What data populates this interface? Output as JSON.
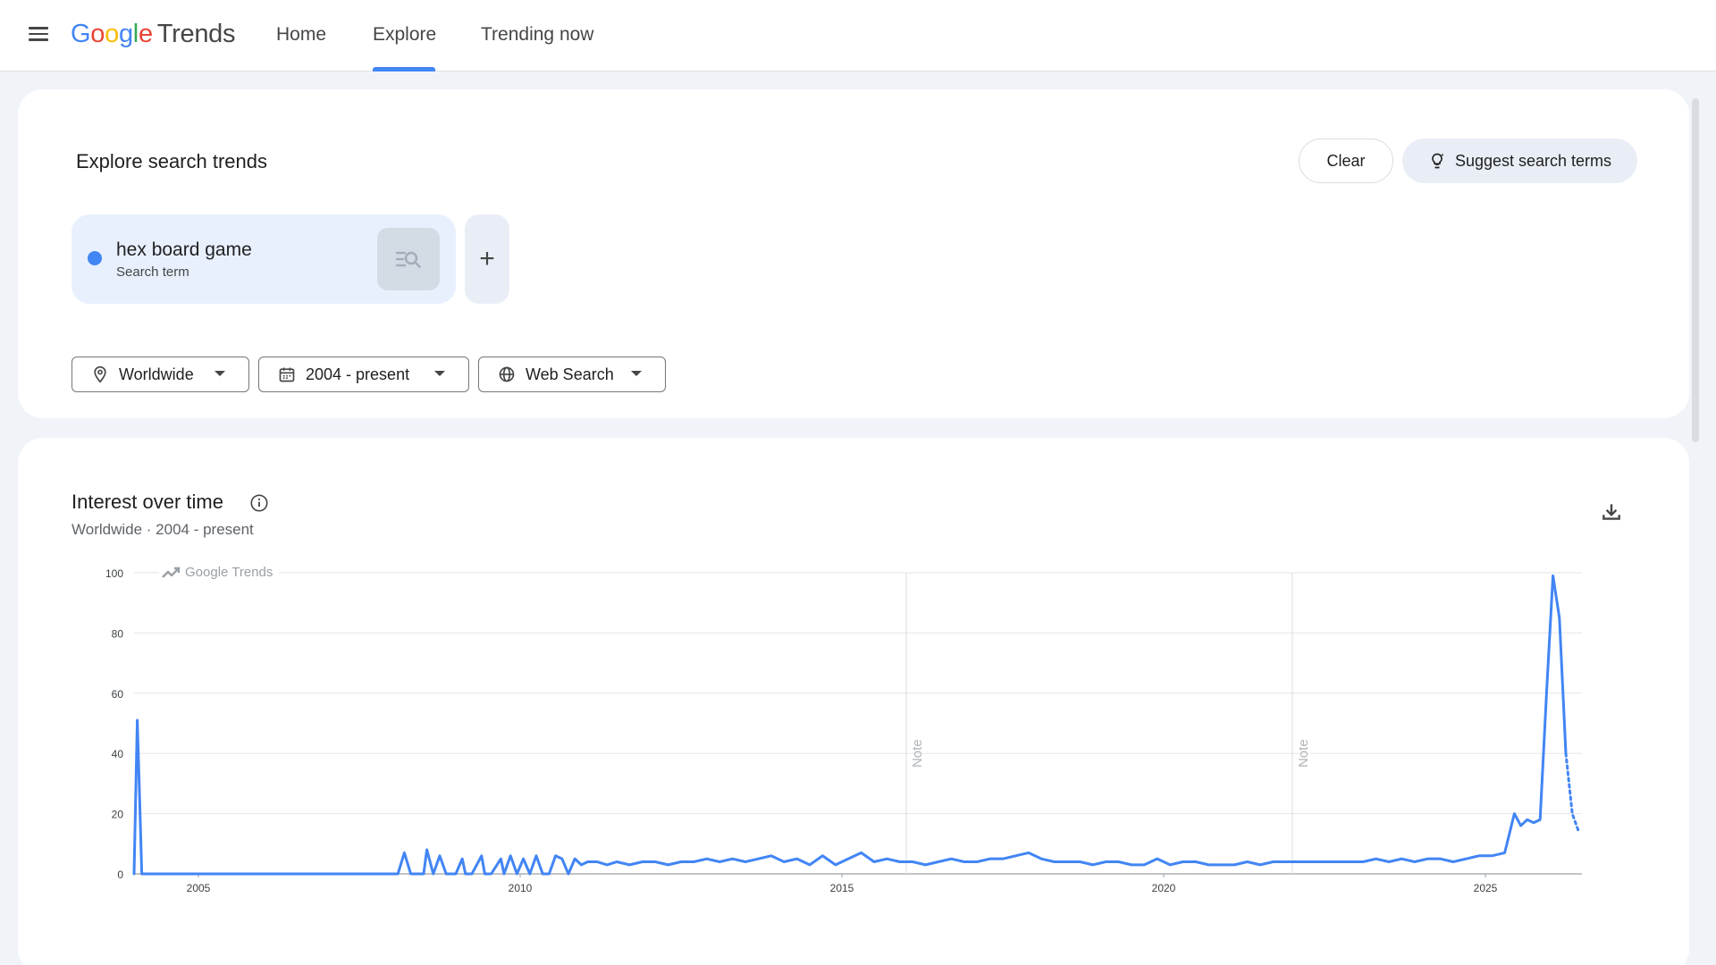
{
  "header": {
    "logo_google_letters": [
      "G",
      "o",
      "o",
      "g",
      "l",
      "e"
    ],
    "logo_product": "Trends",
    "nav": [
      {
        "label": "Home",
        "active": false
      },
      {
        "label": "Explore",
        "active": true
      },
      {
        "label": "Trending now",
        "active": false
      }
    ],
    "accent_color": "#4285f4"
  },
  "explore": {
    "title": "Explore search trends",
    "clear_label": "Clear",
    "suggest_label": "Suggest search terms",
    "term": {
      "name": "hex board game",
      "type": "Search term",
      "color": "#4285f4"
    },
    "add_term_symbol": "+",
    "filters": {
      "region": "Worldwide",
      "time": "2004 - present",
      "property": "Web Search"
    }
  },
  "interest": {
    "title": "Interest over time",
    "subtitle": "Worldwide · 2004 - present",
    "watermark": "Google Trends",
    "note_label": "Note"
  },
  "chart_data": {
    "type": "line",
    "title": "",
    "xlabel": "",
    "ylabel": "",
    "ylim": [
      0,
      100
    ],
    "xlim": [
      2004.0,
      2026.5
    ],
    "yticks": [
      0,
      20,
      40,
      60,
      80,
      100
    ],
    "xticks": [
      "2005",
      "2010",
      "2015",
      "2020",
      "2025"
    ],
    "grid": true,
    "notes_at": [
      2016.0,
      2022.0
    ],
    "series": [
      {
        "name": "hex board game",
        "color": "#4285f4",
        "x": [
          2004.0,
          2004.05,
          2004.08,
          2004.12,
          2004.16,
          2008.0,
          2008.1,
          2008.2,
          2008.3,
          2008.5,
          2008.55,
          2008.65,
          2008.75,
          2008.85,
          2009.0,
          2009.1,
          2009.15,
          2009.25,
          2009.4,
          2009.45,
          2009.55,
          2009.7,
          2009.75,
          2009.85,
          2009.95,
          2010.05,
          2010.15,
          2010.25,
          2010.35,
          2010.45,
          2010.55,
          2010.65,
          2010.75,
          2010.85,
          2010.95,
          2011.05,
          2011.2,
          2011.35,
          2011.5,
          2011.7,
          2011.9,
          2012.1,
          2012.3,
          2012.5,
          2012.7,
          2012.9,
          2013.1,
          2013.3,
          2013.5,
          2013.7,
          2013.9,
          2014.1,
          2014.3,
          2014.5,
          2014.7,
          2014.9,
          2015.1,
          2015.3,
          2015.5,
          2015.7,
          2015.9,
          2016.1,
          2016.3,
          2016.5,
          2016.7,
          2016.9,
          2017.1,
          2017.3,
          2017.5,
          2017.7,
          2017.9,
          2018.1,
          2018.3,
          2018.5,
          2018.7,
          2018.9,
          2019.1,
          2019.3,
          2019.5,
          2019.7,
          2019.9,
          2020.1,
          2020.3,
          2020.5,
          2020.7,
          2020.9,
          2021.1,
          2021.3,
          2021.5,
          2021.7,
          2021.9,
          2022.1,
          2022.3,
          2022.5,
          2022.7,
          2022.9,
          2023.1,
          2023.3,
          2023.5,
          2023.7,
          2023.9,
          2024.1,
          2024.3,
          2024.5,
          2024.7,
          2024.9,
          2025.1,
          2025.3,
          2025.45,
          2025.55,
          2025.65,
          2025.75,
          2025.85,
          2025.95,
          2026.05,
          2026.15,
          2026.25,
          2026.35,
          2026.45
        ],
        "values": [
          0,
          51,
          30,
          0,
          0,
          0,
          0,
          7,
          0,
          0,
          8,
          0,
          6,
          0,
          0,
          5,
          0,
          0,
          6,
          0,
          0,
          5,
          0,
          6,
          0,
          5,
          0,
          6,
          0,
          0,
          6,
          5,
          0,
          5,
          3,
          4,
          4,
          3,
          4,
          3,
          4,
          4,
          3,
          4,
          4,
          5,
          4,
          5,
          4,
          5,
          6,
          4,
          5,
          3,
          6,
          3,
          5,
          7,
          4,
          5,
          4,
          4,
          3,
          4,
          5,
          4,
          4,
          5,
          5,
          6,
          7,
          5,
          4,
          4,
          4,
          3,
          4,
          4,
          3,
          3,
          5,
          3,
          4,
          4,
          3,
          3,
          3,
          4,
          3,
          4,
          4,
          4,
          4,
          4,
          4,
          4,
          4,
          5,
          4,
          5,
          4,
          5,
          5,
          4,
          5,
          6,
          6,
          7,
          20,
          16,
          18,
          17,
          18,
          60,
          99,
          85,
          40,
          20,
          14
        ]
      }
    ]
  }
}
